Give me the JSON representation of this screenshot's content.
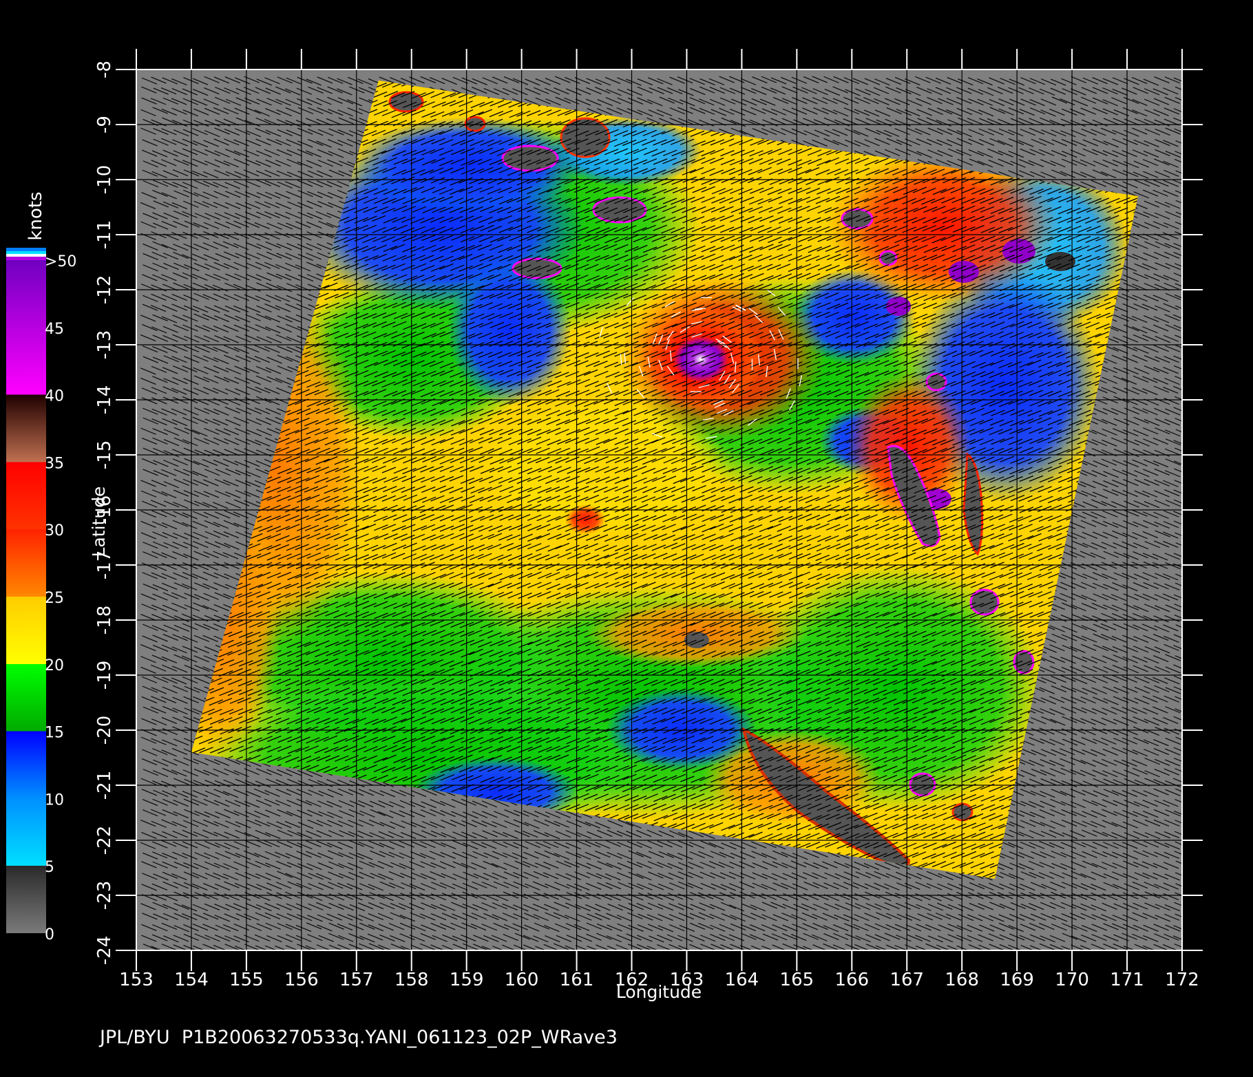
{
  "figure": {
    "footer_text": "JPL/BYU  P1B20063270533q.YANI_061123_02P_WRave3",
    "xlabel": "Longitude",
    "ylabel": "Latitude",
    "colorbar_title": "knots"
  },
  "colors": {
    "background": "#000000",
    "plot_background": "#7f7f7f",
    "land_mask": "#555555",
    "grid": "#000000",
    "axis_text": "#ffffff"
  },
  "chart_data": {
    "type": "heatmap",
    "x_ticks": [
      "153",
      "154",
      "155",
      "156",
      "157",
      "158",
      "159",
      "160",
      "161",
      "162",
      "163",
      "164",
      "165",
      "166",
      "167",
      "168",
      "169",
      "170",
      "171",
      "172"
    ],
    "y_ticks": [
      "-8",
      "-9",
      "-10",
      "-11",
      "-12",
      "-13",
      "-14",
      "-15",
      "-16",
      "-17",
      "-18",
      "-19",
      "-20",
      "-21",
      "-22",
      "-23",
      "-24"
    ],
    "xlim": [
      153,
      172
    ],
    "ylim": [
      -24,
      -8
    ],
    "swath_corners_lonlat": [
      [
        157.4,
        -8.2
      ],
      [
        171.2,
        -10.3
      ],
      [
        168.6,
        -22.7
      ],
      [
        154.0,
        -20.4
      ]
    ],
    "colorbar": {
      "ticks": [
        "0",
        "5",
        "10",
        "15",
        "20",
        "25",
        "30",
        "35",
        "40",
        "45",
        ">50"
      ],
      "stops": [
        {
          "value": 0,
          "color": "#7a7a7a"
        },
        {
          "value": 5,
          "color": "#2a2a2a"
        },
        {
          "value": 5,
          "color": "#00e0ff"
        },
        {
          "value": 10,
          "color": "#0090ff"
        },
        {
          "value": 15,
          "color": "#0000ff"
        },
        {
          "value": 15,
          "color": "#00aa00"
        },
        {
          "value": 20,
          "color": "#00ff00"
        },
        {
          "value": 20,
          "color": "#ffff00"
        },
        {
          "value": 25,
          "color": "#ffcc00"
        },
        {
          "value": 25,
          "color": "#ff8800"
        },
        {
          "value": 30,
          "color": "#ff2200"
        },
        {
          "value": 30,
          "color": "#ff3300"
        },
        {
          "value": 35,
          "color": "#ff0000"
        },
        {
          "value": 35,
          "color": "#c07050"
        },
        {
          "value": 40,
          "color": "#200000"
        },
        {
          "value": 40,
          "color": "#ff00ff"
        },
        {
          "value": 50,
          "color": "#7000c0"
        }
      ],
      "max_label": ">50"
    },
    "wind_fields": [
      {
        "feature": "cyclone center (purple/white core)",
        "lon": 163.2,
        "lat": -13.3,
        "speed_knots": 45
      },
      {
        "feature": "strong wind region NE",
        "lon": 169.0,
        "lat": -11.5,
        "speed_knots": 32
      },
      {
        "feature": "strong wind near islands E",
        "lon": 167.8,
        "lat": -15.6,
        "speed_knots": 33
      },
      {
        "feature": "weak wind region NW",
        "lon": 158.8,
        "lat": -11.5,
        "speed_knots": 12
      },
      {
        "feature": "weak wind region E",
        "lon": 169.8,
        "lat": -14.5,
        "speed_knots": 10
      },
      {
        "feature": "moderate winds SW",
        "lon": 156.0,
        "lat": -17.0,
        "speed_knots": 26
      },
      {
        "feature": "central moderate winds",
        "lon": 163.0,
        "lat": -17.5,
        "speed_knots": 22
      },
      {
        "feature": "southern weaker band",
        "lon": 161.0,
        "lat": -20.3,
        "speed_knots": 15
      }
    ]
  }
}
